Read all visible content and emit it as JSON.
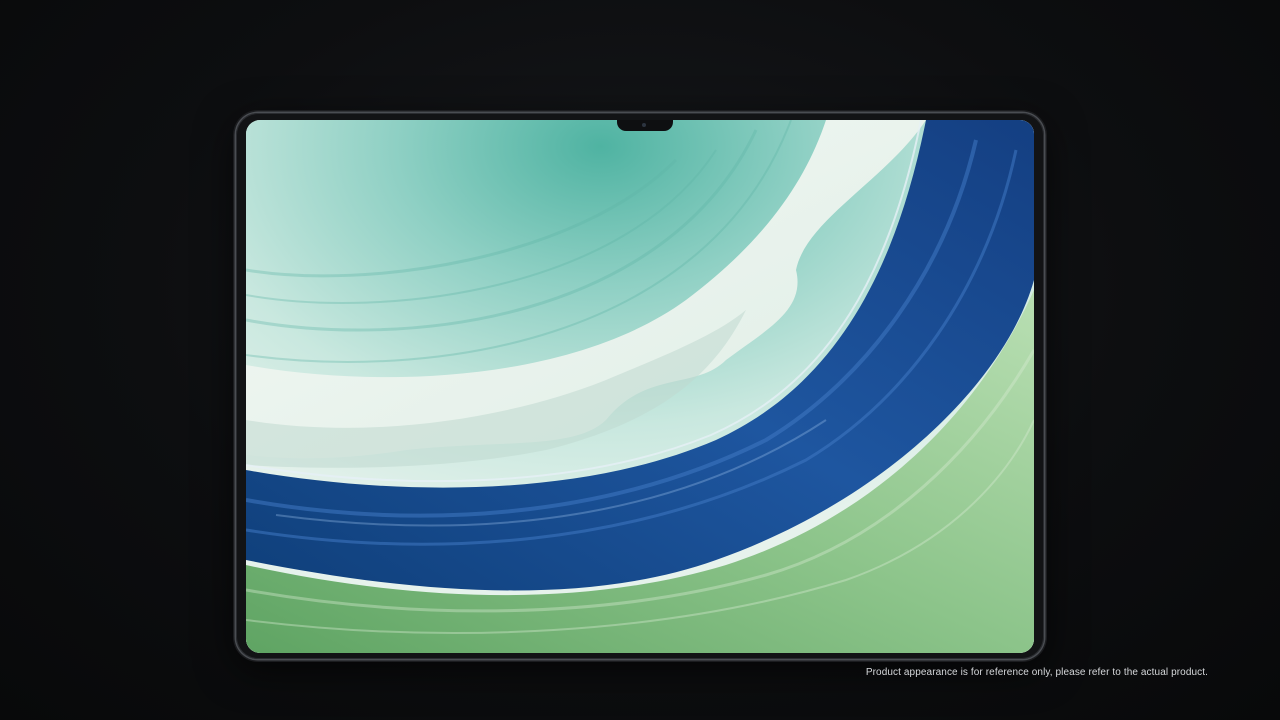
{
  "disclaimer": "Product appearance is for reference only, please refer to the actual product.",
  "colors": {
    "background": "#0b0c0e",
    "bezel": "#121315",
    "wallpaper_teal": "#8fcfc4",
    "wallpaper_white": "#eef3ee",
    "wallpaper_blue": "#1f4f8f",
    "wallpaper_green": "#7fb37a"
  },
  "image": {
    "subject": "tablet",
    "wallpaper": "abstract teal, white, blue and green flowing waves"
  }
}
